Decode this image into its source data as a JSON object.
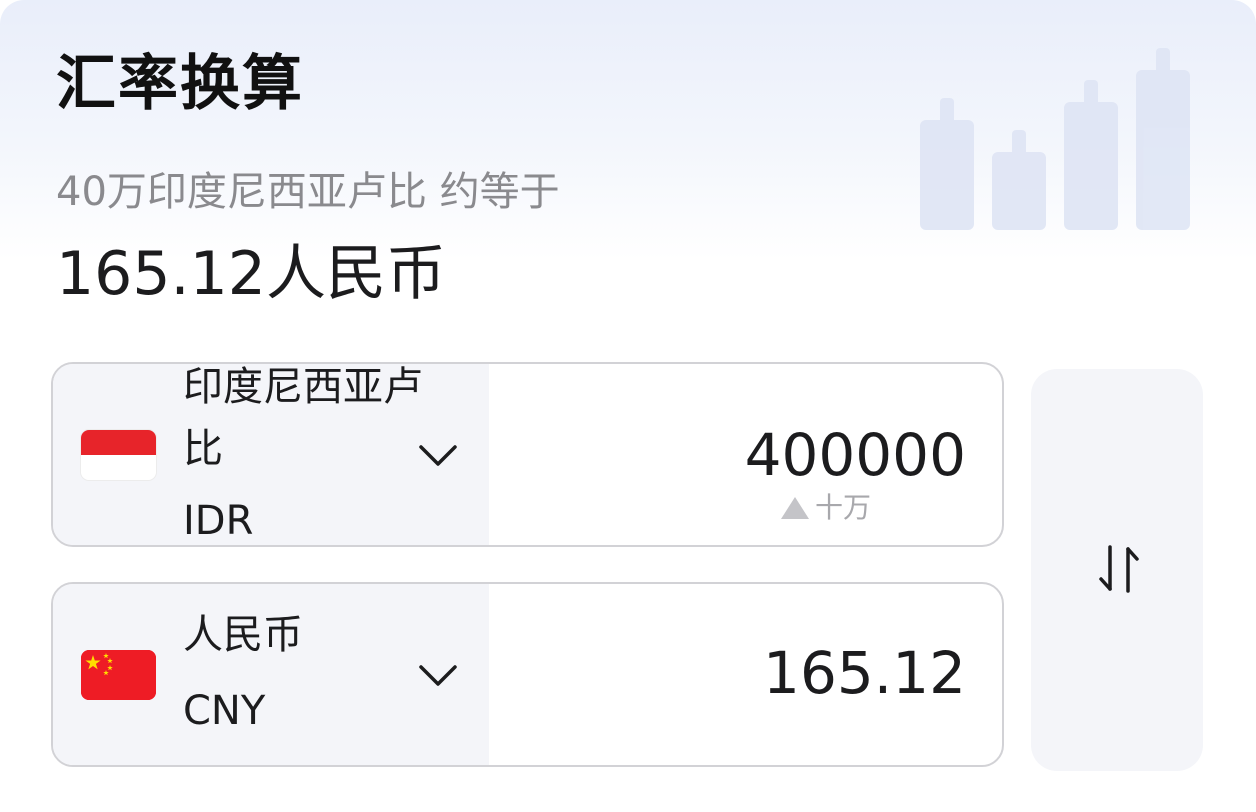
{
  "header": {
    "title": "汇率换算"
  },
  "summary": {
    "subtitle": "40万印度尼西亚卢比 约等于",
    "result": "165.12人民币"
  },
  "from_currency": {
    "name": "印度尼西亚卢比",
    "code": "IDR",
    "flag_icon": "indonesia-flag-icon",
    "amount": "400000",
    "unit_hint": "十万"
  },
  "to_currency": {
    "name": "人民币",
    "code": "CNY",
    "flag_icon": "china-flag-icon",
    "amount": "165.12"
  },
  "icons": {
    "dropdown": "chevron-down-icon",
    "swap": "swap-arrows-icon"
  },
  "colors": {
    "accent_bg": "#e9eefa",
    "panel_bg": "#f4f5f9",
    "indonesia_red": "#e7242a",
    "china_red": "#ee1c25",
    "china_yellow": "#ffde00"
  }
}
